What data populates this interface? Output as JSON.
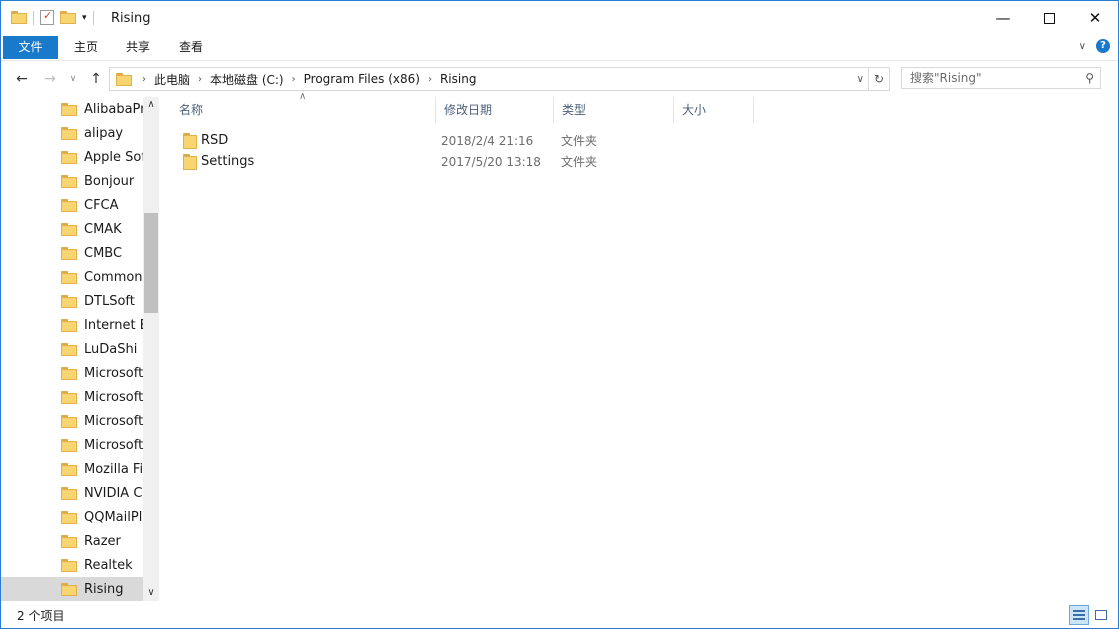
{
  "window": {
    "title": "Rising"
  },
  "ribbon": {
    "tabs": [
      {
        "label": "文件"
      },
      {
        "label": "主页"
      },
      {
        "label": "共享"
      },
      {
        "label": "查看"
      }
    ]
  },
  "address": {
    "crumbs": [
      "此电脑",
      "本地磁盘 (C:)",
      "Program Files (x86)",
      "Rising"
    ]
  },
  "search": {
    "placeholder": "搜索\"Rising\""
  },
  "nav_tree": {
    "items": [
      {
        "label": "AlibabaProtect"
      },
      {
        "label": "alipay"
      },
      {
        "label": "Apple Software"
      },
      {
        "label": "Bonjour"
      },
      {
        "label": "CFCA"
      },
      {
        "label": "CMAK"
      },
      {
        "label": "CMBC"
      },
      {
        "label": "Common Files"
      },
      {
        "label": "DTLSoft"
      },
      {
        "label": "Internet Explorer"
      },
      {
        "label": "LuDaShi"
      },
      {
        "label": "Microsoft Analysis"
      },
      {
        "label": "Microsoft Office"
      },
      {
        "label": "Microsoft SQL"
      },
      {
        "label": "Microsoft.NET"
      },
      {
        "label": "Mozilla Firefox"
      },
      {
        "label": "NVIDIA Corporation"
      },
      {
        "label": "QQMailPlugin"
      },
      {
        "label": "Razer"
      },
      {
        "label": "Realtek"
      },
      {
        "label": "Rising",
        "selected": true
      }
    ]
  },
  "columns": {
    "name": "名称",
    "modified": "修改日期",
    "type": "类型",
    "size": "大小"
  },
  "files": [
    {
      "name": "RSD",
      "modified": "2018/2/4 21:16",
      "type": "文件夹"
    },
    {
      "name": "Settings",
      "modified": "2017/5/20 13:18",
      "type": "文件夹"
    }
  ],
  "status": {
    "count": "2 个项目"
  },
  "colors": {
    "accent": "#1979ca",
    "selected": "#d9d9d9",
    "folder": "#f7d672"
  }
}
